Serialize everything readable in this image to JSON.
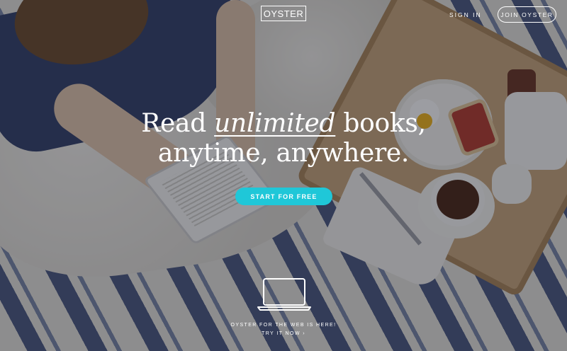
{
  "header": {
    "logo_text": "OYSTER",
    "sign_in_label": "SIGN IN",
    "join_label": "JOIN OYSTER"
  },
  "hero": {
    "headline_before": "Read ",
    "headline_emphasis": "unlimited",
    "headline_after": " books,",
    "headline_line2": "anytime, anywhere.",
    "cta_label": "START FOR FREE"
  },
  "promo": {
    "icon": "laptop-icon",
    "text": "OYSTER FOR THE WEB IS HERE!",
    "link_label": "TRY IT NOW ›"
  },
  "colors": {
    "accent": "#1fc7d8",
    "text": "#ffffff",
    "overlay": "rgba(18,22,34,0.42)"
  }
}
